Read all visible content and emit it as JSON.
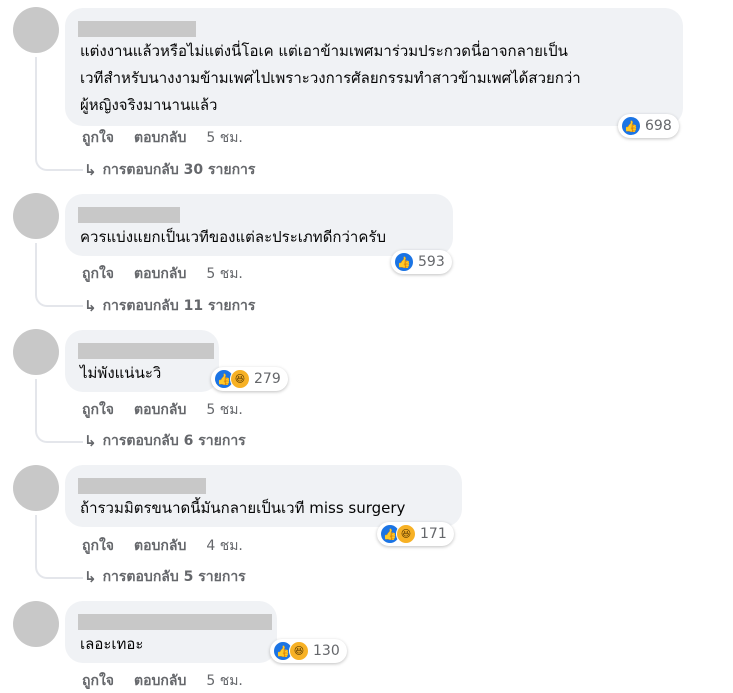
{
  "comments": [
    {
      "text": "แต่งงานแล้วหรือไม่แต่งนี่โอเค แต่เอาข้ามเพศมาร่วมประกวดนี่อาจกลายเป็น\nเวทีสำหรับนางงามข้ามเพศไปเพราะวงการศัลยกรรมทำสาวข้ามเพศได้สวยกว่า\nผู้หญิงจริงมานานแล้ว",
      "reaction_count": "698",
      "like_label": "ถูกใจ",
      "reply_label": "ตอบกลับ",
      "time": "5 ชม.",
      "replies_text": "การตอบกลับ 30 รายการ"
    },
    {
      "text": "ควรแบ่งแยกเป็นเวทีของแต่ละประเภทดีกว่าครับ",
      "reaction_count": "593",
      "like_label": "ถูกใจ",
      "reply_label": "ตอบกลับ",
      "time": "5 ชม.",
      "replies_text": "การตอบกลับ 11 รายการ"
    },
    {
      "text": "ไม่พังแน่นะวิ",
      "reaction_count": "279",
      "like_label": "ถูกใจ",
      "reply_label": "ตอบกลับ",
      "time": "5 ชม.",
      "replies_text": "การตอบกลับ 6 รายการ"
    },
    {
      "text": "ถ้ารวมมิตรขนาดนี้มันกลายเป็นเวที miss surgery",
      "reaction_count": "171",
      "like_label": "ถูกใจ",
      "reply_label": "ตอบกลับ",
      "time": "4 ชม.",
      "replies_text": "การตอบกลับ 5 รายการ"
    },
    {
      "text": "เลอะเทอะ",
      "reaction_count": "130",
      "like_label": "ถูกใจ",
      "reply_label": "ตอบกลับ",
      "time": "5 ชม."
    }
  ],
  "icons": {
    "like": "like-reaction-icon",
    "haha": "haha-reaction-icon",
    "reply_arrow": "reply-arrow-icon"
  },
  "colors": {
    "like_blue": "#1b74e4",
    "haha_yellow": "#f7b125",
    "bubble_bg": "#f0f2f5",
    "meta_gray": "#65676b"
  }
}
